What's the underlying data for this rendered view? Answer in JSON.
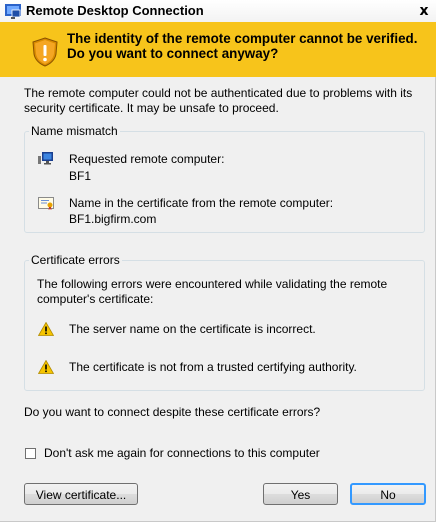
{
  "window": {
    "title": "Remote Desktop Connection",
    "close_glyph": "x"
  },
  "banner": {
    "icon": "security-shield-warning-icon",
    "heading": "The identity of the remote computer cannot be verified. Do you want to connect anyway?"
  },
  "intro": "The remote computer could not be authenticated due to problems with its security certificate. It may be unsafe to proceed.",
  "name_mismatch": {
    "legend": "Name mismatch",
    "requested_label": "Requested remote computer:",
    "requested_value": "BF1",
    "cert_label": "Name in the certificate from the remote computer:",
    "cert_value": "BF1.bigfirm.com"
  },
  "certificate_errors": {
    "legend": "Certificate errors",
    "description": "The following errors were encountered while validating the remote computer's certificate:",
    "errors": [
      "The server name on the certificate is incorrect.",
      "The certificate is not from a trusted certifying authority."
    ]
  },
  "question": "Do you want to connect despite these certificate errors?",
  "dont_ask": {
    "label": "Don't ask me again for connections to this computer",
    "checked": false
  },
  "buttons": {
    "view_certificate": "View certificate...",
    "yes": "Yes",
    "no": "No"
  },
  "colors": {
    "banner": "#f7c41b",
    "focus_border": "#3399ff"
  }
}
